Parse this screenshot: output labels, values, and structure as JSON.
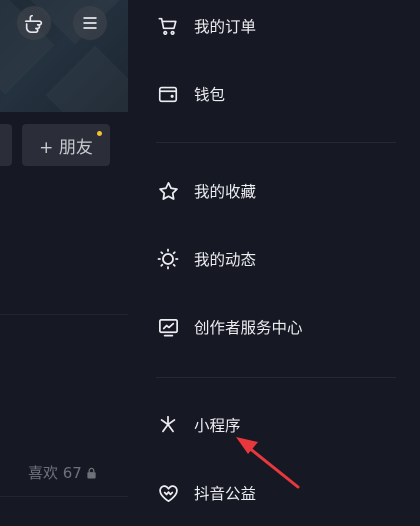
{
  "profile": {
    "add_friend_label": "+ 朋友",
    "likes_label": "喜欢 67"
  },
  "menu": {
    "items": [
      {
        "label": "我的订单",
        "icon": "cart-icon"
      },
      {
        "label": "钱包",
        "icon": "wallet-icon"
      },
      {
        "label": "我的收藏",
        "icon": "star-icon"
      },
      {
        "label": "我的动态",
        "icon": "sun-icon"
      },
      {
        "label": "创作者服务中心",
        "icon": "chart-monitor-icon"
      },
      {
        "label": "小程序",
        "icon": "miniapp-icon"
      },
      {
        "label": "抖音公益",
        "icon": "heart-icon"
      }
    ]
  },
  "colors": {
    "background": "#161823",
    "text": "#ecedf0",
    "annotation_arrow": "#e8383d",
    "notification_dot": "#f2c230"
  }
}
